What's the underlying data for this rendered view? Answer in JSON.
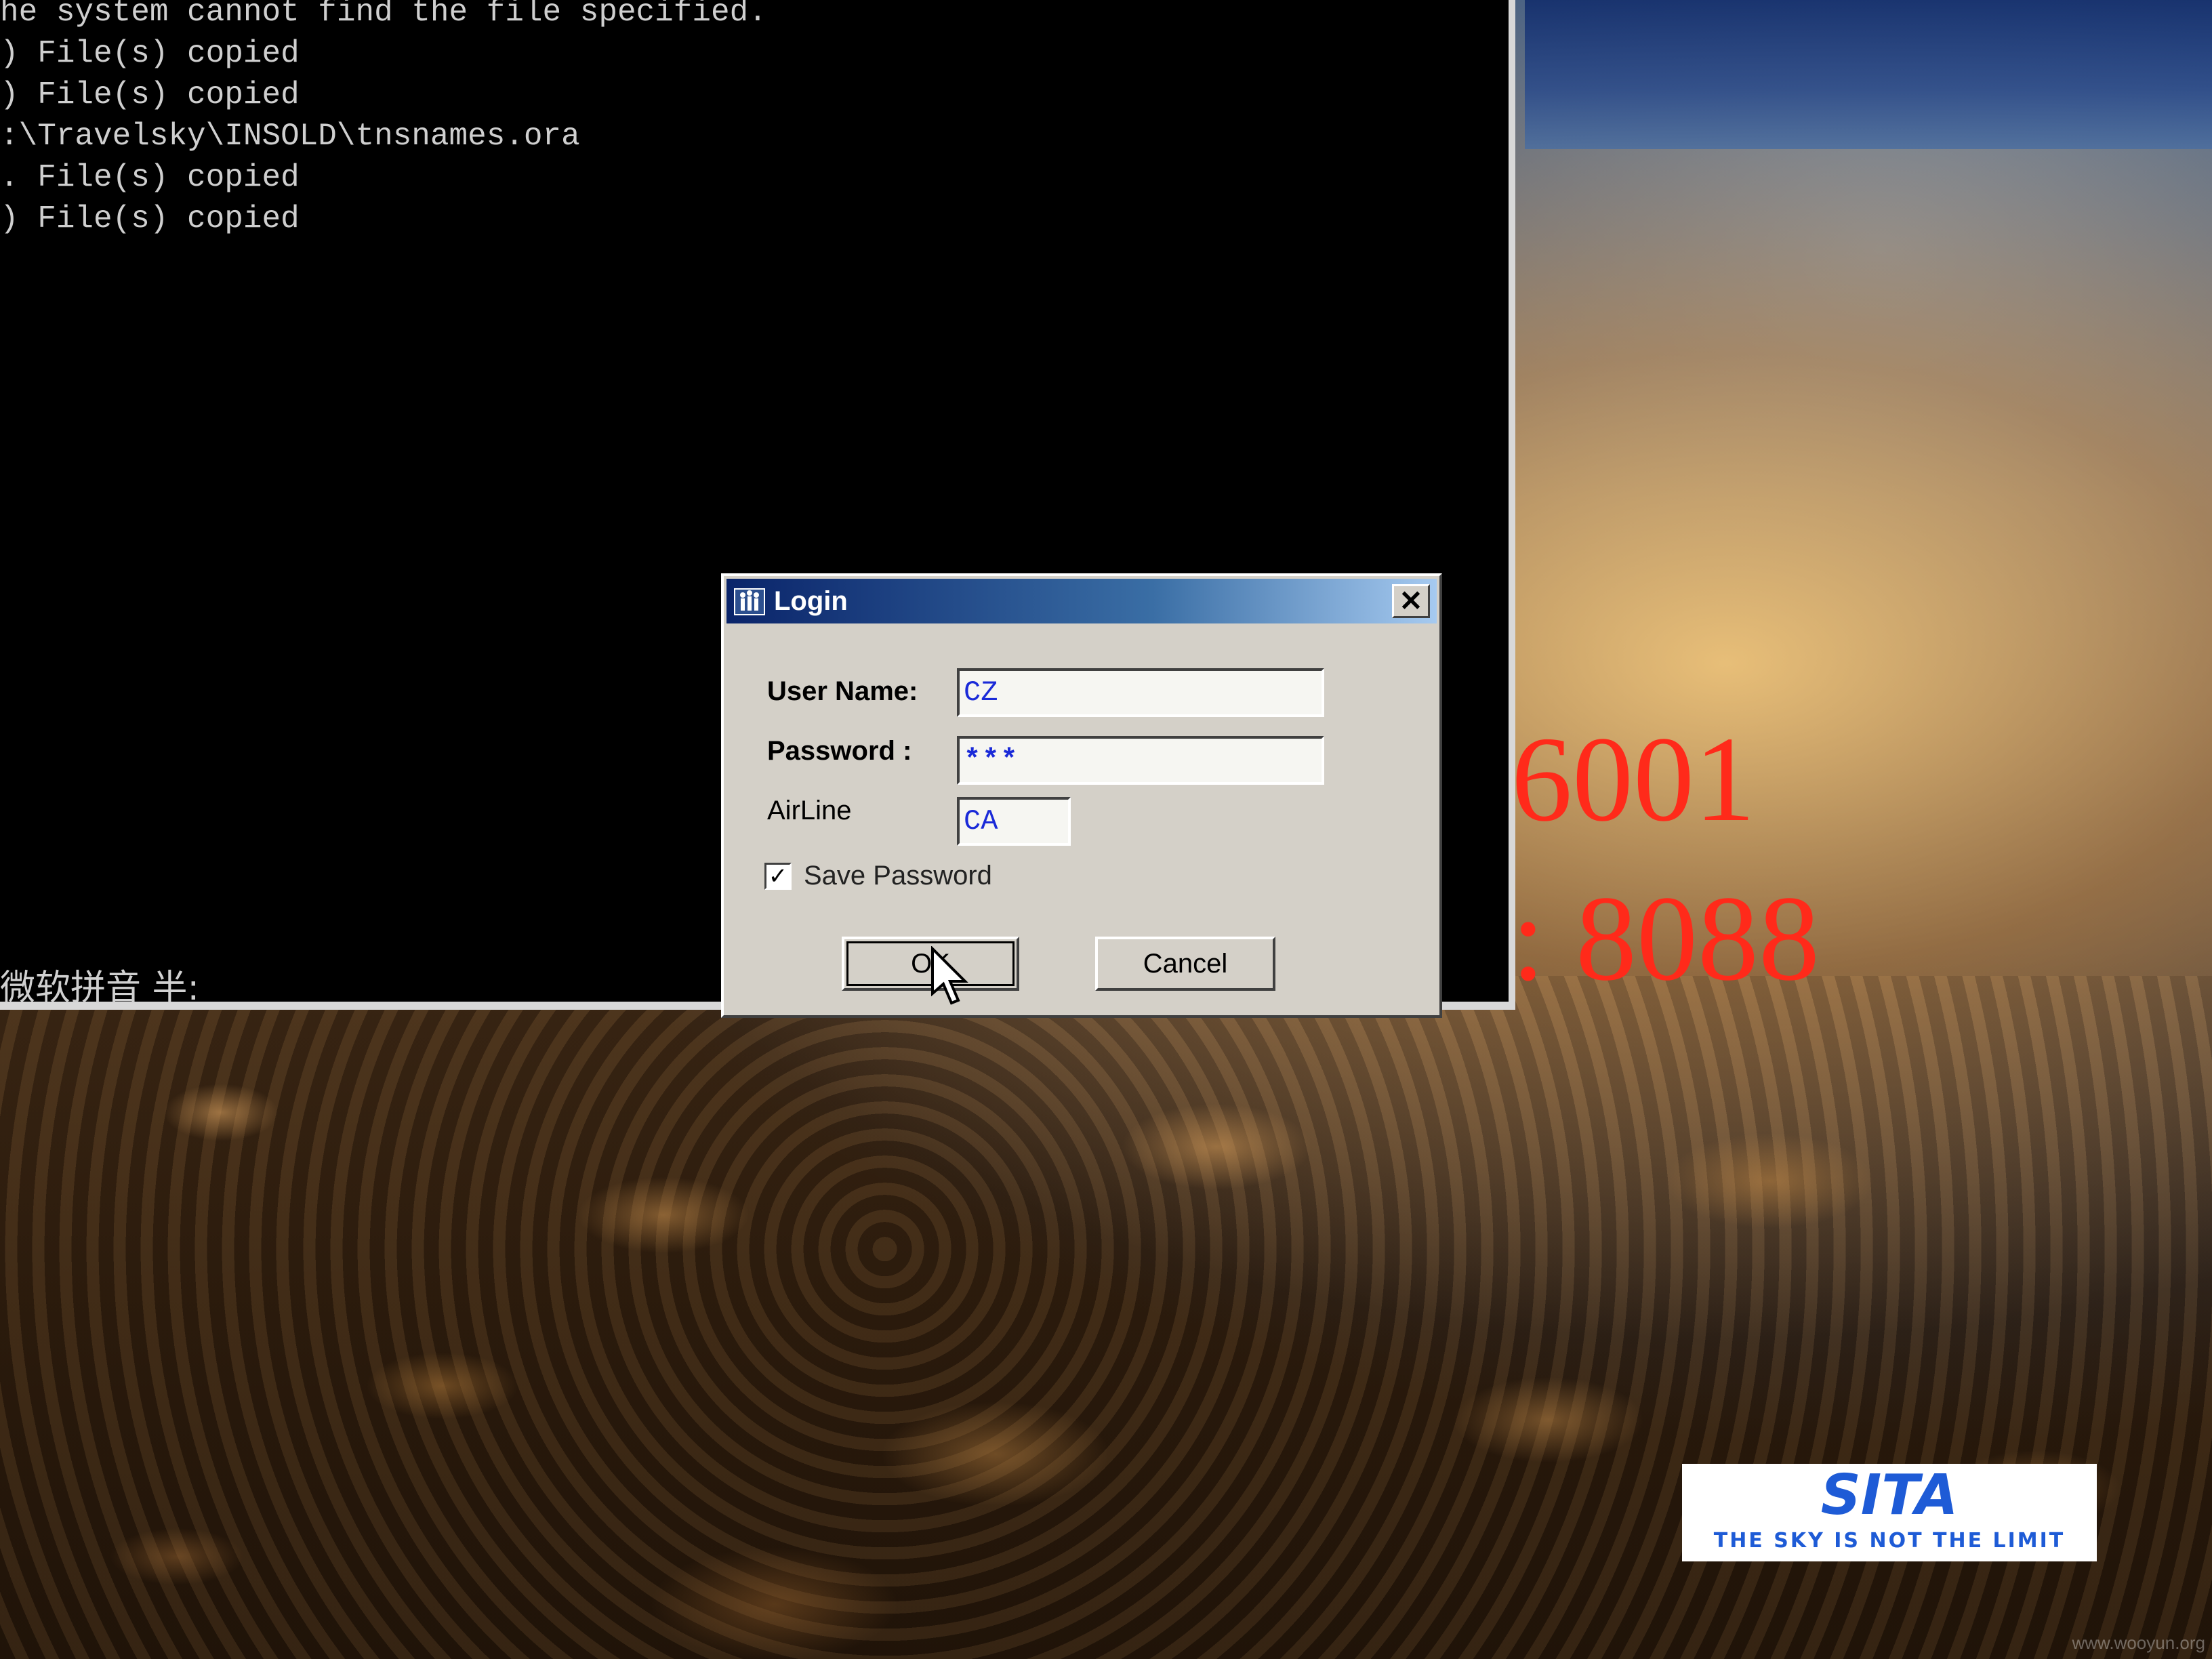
{
  "console": {
    "lines": [
      "he system cannot find the file specified.",
      ") File(s) copied",
      ") File(s) copied",
      ":\\Travelsky\\INSOLD\\tnsnames.ora",
      ". File(s) copied",
      ") File(s) copied"
    ],
    "ime_status": "微软拼音 半:"
  },
  "background": {
    "port_1": "6001",
    "port_2": ": 8088",
    "sita_brand": "SITA",
    "sita_tagline": "THE SKY IS NOT THE LIMIT",
    "watermark": "www.wooyun.org"
  },
  "login_dialog": {
    "title": "Login",
    "icon": "app-people-icon",
    "close_glyph": "✕",
    "user_name_label": "User Name:",
    "user_name_value": "CZ",
    "password_label": "Password :",
    "password_value": "***",
    "airline_label": "AirLine",
    "airline_value": "CA",
    "save_password_label": "Save Password",
    "save_password_checked": true,
    "ok_label": "OK",
    "cancel_label": "Cancel"
  },
  "colors": {
    "titlebar_start": "#0a246a",
    "titlebar_end": "#a6caf0",
    "input_text": "#1a2ad8",
    "port_text": "#ff2a1a",
    "sita_blue": "#1e5bd6"
  }
}
